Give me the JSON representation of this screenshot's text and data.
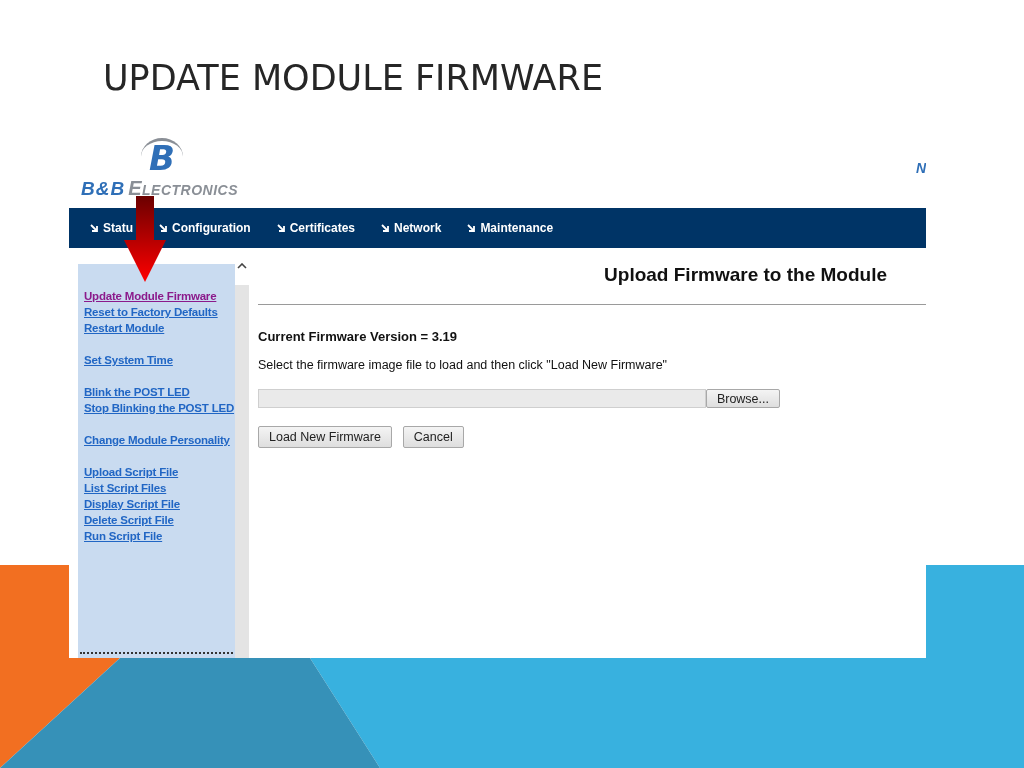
{
  "slide_title": "UPDATE MODULE FIRMWARE",
  "logo": {
    "mark": "B",
    "brand": "B&B",
    "suffix": "ELECTRONICS"
  },
  "header_edge_text": "N",
  "nav": [
    {
      "label": "Statu"
    },
    {
      "label": "Configuration"
    },
    {
      "label": "Certificates"
    },
    {
      "label": "Network"
    },
    {
      "label": "Maintenance"
    }
  ],
  "sidebar": {
    "groups": [
      [
        {
          "label": "Update Module Firmware",
          "visited": true
        },
        {
          "label": "Reset to Factory Defaults",
          "visited": false
        },
        {
          "label": "Restart Module",
          "visited": false
        }
      ],
      [
        {
          "label": "Set System Time",
          "visited": false
        }
      ],
      [
        {
          "label": "Blink the POST LED",
          "visited": false
        },
        {
          "label": "Stop Blinking the POST LED",
          "visited": false
        }
      ],
      [
        {
          "label": "Change Module Personality",
          "visited": false
        }
      ],
      [
        {
          "label": "Upload Script File",
          "visited": false
        },
        {
          "label": "List Script Files",
          "visited": false
        },
        {
          "label": "Display Script File",
          "visited": false
        },
        {
          "label": "Delete Script File",
          "visited": false
        },
        {
          "label": "Run Script File",
          "visited": false
        }
      ]
    ]
  },
  "main": {
    "heading": "Upload Firmware to the Module",
    "version": "Current Firmware Version = 3.19",
    "instruction": "Select the firmware image file to load and then click \"Load New Firmware\"",
    "browse_button": "Browse...",
    "buttons": [
      "Load New Firmware",
      "Cancel"
    ]
  }
}
